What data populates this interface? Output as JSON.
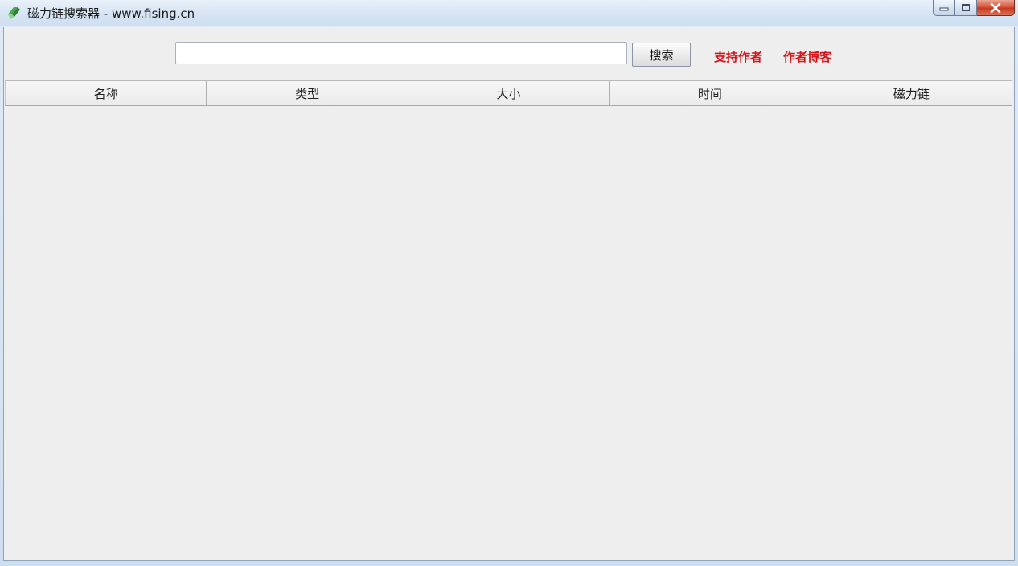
{
  "window": {
    "title": "磁力链搜索器 - www.fising.cn",
    "icon": "magnet-app-icon",
    "controls": {
      "minimize_icon": "minimize-icon",
      "maximize_icon": "maximize-icon",
      "close_icon": "close-icon"
    }
  },
  "search": {
    "input_value": "",
    "button_label": "搜索"
  },
  "links": {
    "support_author": "支持作者",
    "author_blog": "作者博客",
    "color": "#d7141a"
  },
  "table": {
    "columns": [
      "名称",
      "类型",
      "大小",
      "时间",
      "磁力链"
    ],
    "rows": []
  }
}
